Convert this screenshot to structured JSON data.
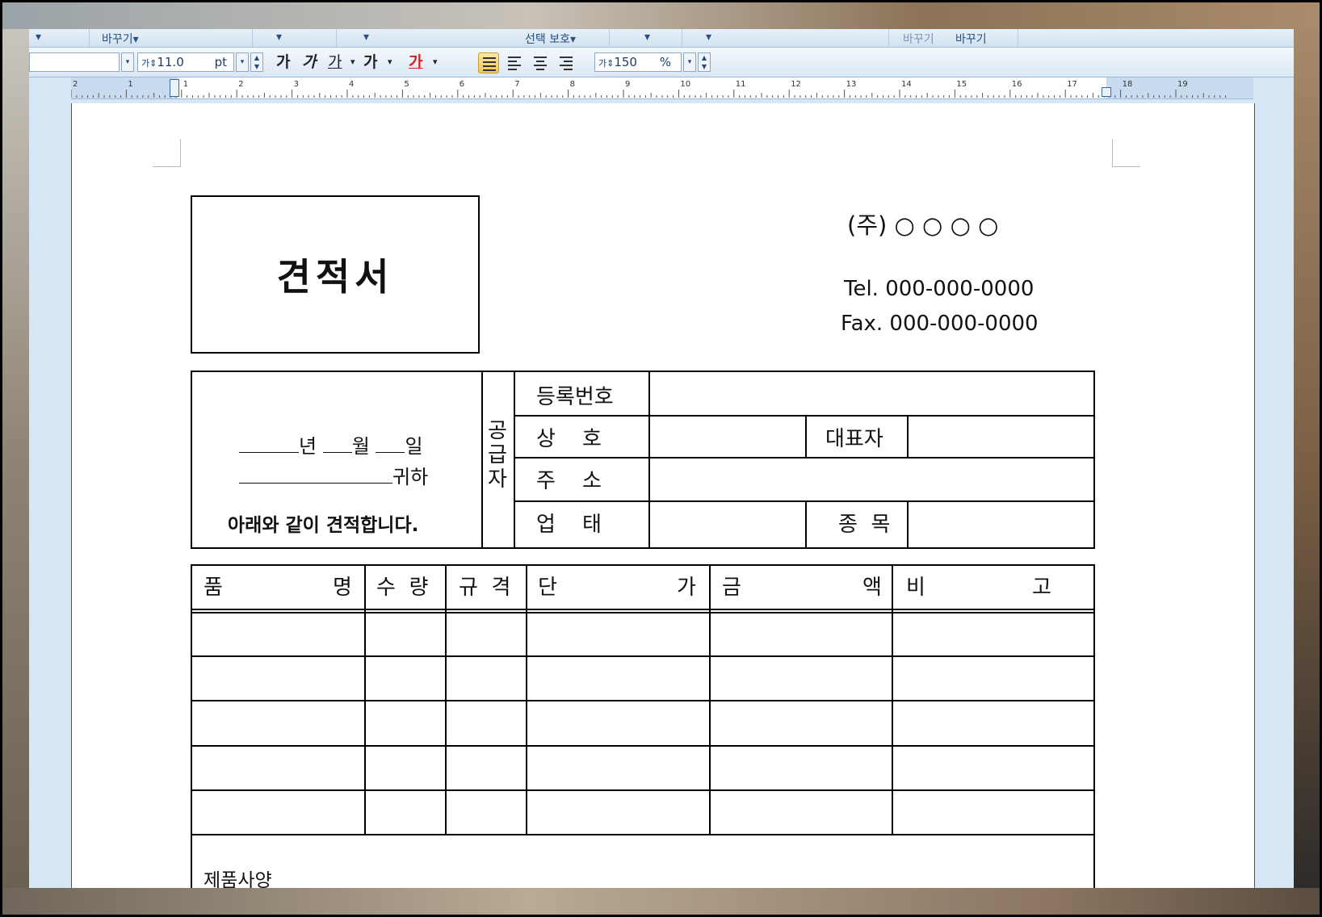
{
  "toolbar_top": {
    "items": [
      "바꾸기",
      "선택 보호",
      "바꾸기",
      "바꾸기"
    ]
  },
  "toolbar_format": {
    "font_size_value": "11.0",
    "font_size_unit": "pt",
    "bold_label": "가",
    "italic_label": "가",
    "underline_label": "가",
    "strike_label": "가",
    "color_label": "가",
    "line_spacing_value": "150",
    "line_spacing_unit": "%"
  },
  "ruler": {
    "labels": [
      "2",
      "1",
      "1",
      "2",
      "3",
      "4",
      "5",
      "6",
      "7",
      "8",
      "9",
      "10",
      "11",
      "12",
      "13",
      "14",
      "15",
      "16",
      "17",
      "18",
      "19"
    ]
  },
  "document": {
    "title": "견적서",
    "company": "(주) ○ ○ ○ ○",
    "tel": "Tel.  000-000-0000",
    "fax": "Fax.  000-000-0000",
    "date_year": "년",
    "date_month": "월",
    "date_day": "일",
    "honorific": "귀하",
    "intro": "아래와 같이 견적합니다.",
    "supplier_label": "공\n급\n자",
    "reg_no": "등록번호",
    "trade_name": "상    호",
    "representative": "대표자",
    "address": "주    소",
    "business_type": "업    태",
    "business_item": "종  목",
    "item_headers": [
      "품",
      "명",
      "수  량",
      "규  격",
      "단",
      "가",
      "금",
      "액",
      "비",
      "고"
    ],
    "spec_label": "제품사양"
  },
  "colors": {
    "app_bg": "#d6e6f4",
    "toolbar": "#dbe8f4",
    "accent_active": "#f6c65a",
    "text_color_red": "#d32020"
  }
}
